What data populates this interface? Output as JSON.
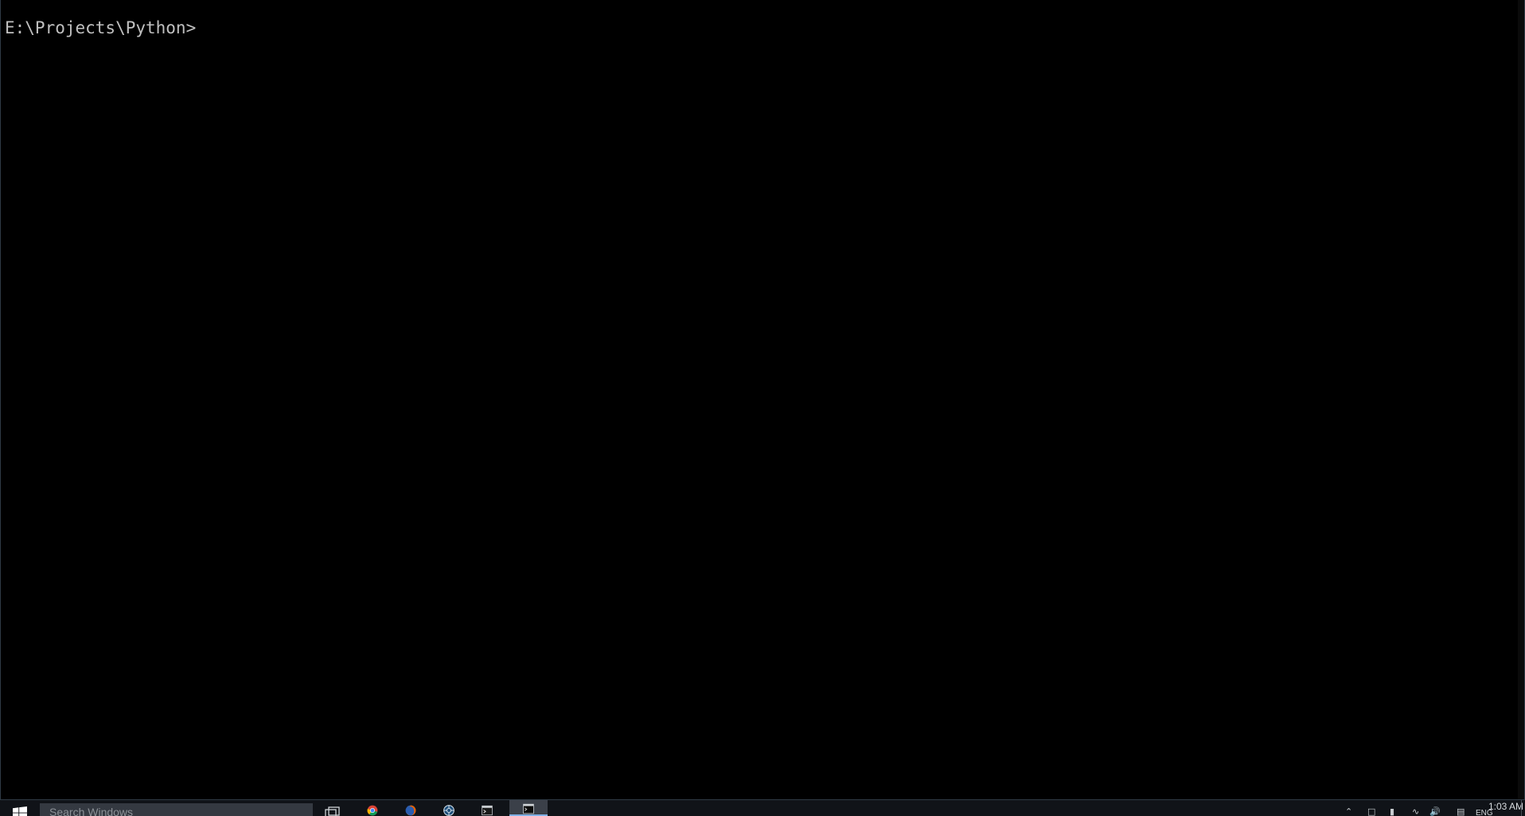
{
  "console": {
    "prompt": "E:\\Projects\\Python>",
    "background_color": "#000000",
    "text_color": "#c0c0c0"
  },
  "taskbar": {
    "search_placeholder": "Search Windows",
    "pinned_apps": [
      {
        "icon": "task-view-icon"
      },
      {
        "icon": "chrome-icon"
      },
      {
        "icon": "firefox-icon"
      },
      {
        "icon": "app-icon"
      },
      {
        "icon": "terminal-icon"
      },
      {
        "icon": "cmd-icon",
        "active": true
      }
    ],
    "accent_color": "#7fb0e6",
    "background_color": "#101318"
  },
  "tray": {
    "language": "ENG",
    "time": "1:03 AM"
  }
}
